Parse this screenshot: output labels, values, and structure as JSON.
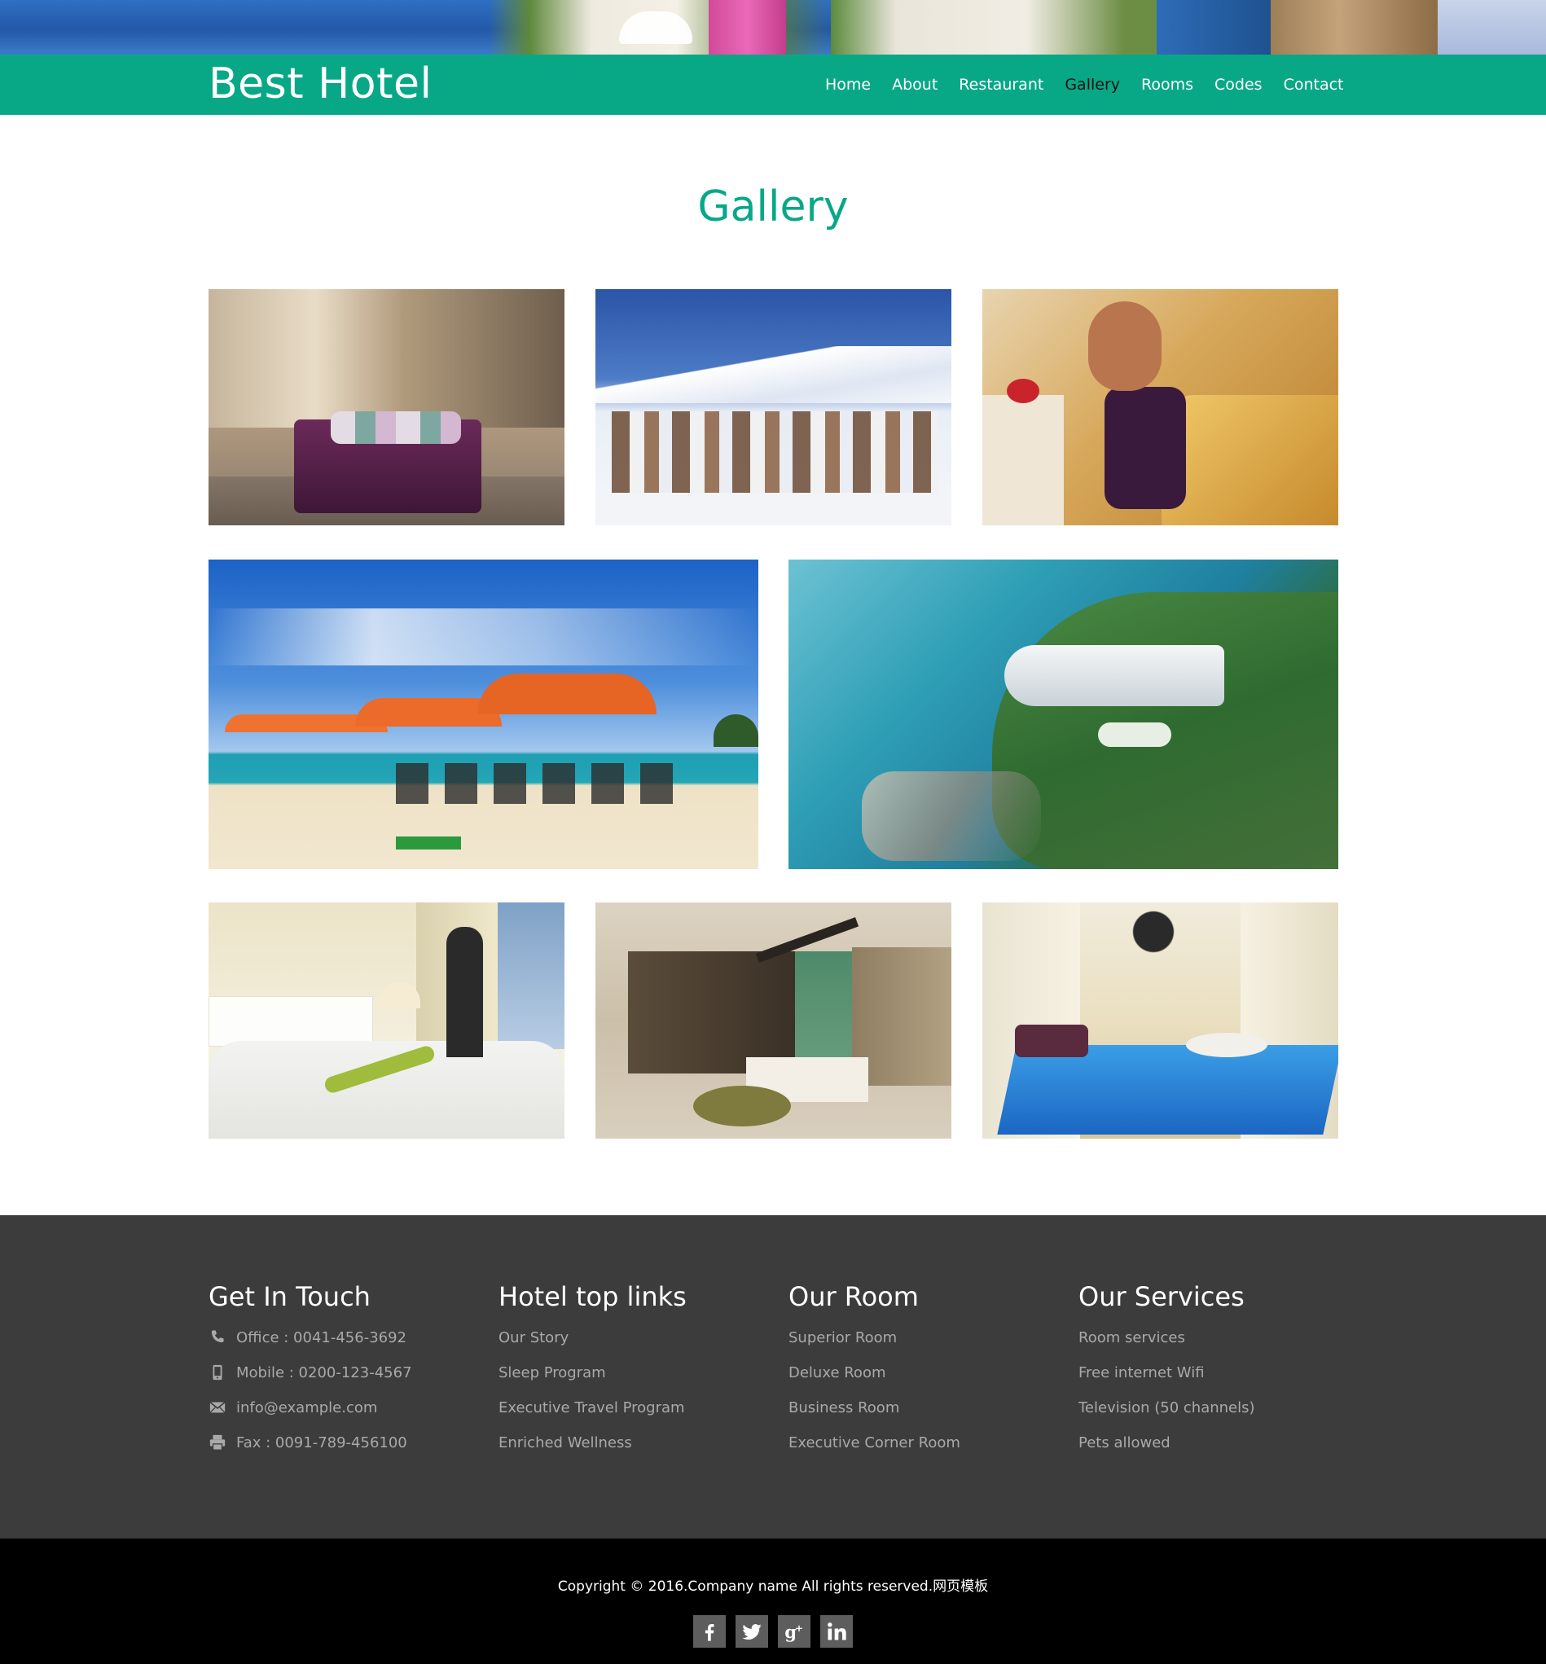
{
  "site": {
    "brand": "Best Hotel",
    "nav": [
      {
        "label": "Home",
        "active": false
      },
      {
        "label": "About",
        "active": false
      },
      {
        "label": "Restaurant",
        "active": false
      },
      {
        "label": "Gallery",
        "active": true
      },
      {
        "label": "Rooms",
        "active": false
      },
      {
        "label": "Codes",
        "active": false
      },
      {
        "label": "Contact",
        "active": false
      }
    ],
    "accent_color": "#08a887",
    "active_nav_color": "#111111"
  },
  "gallery": {
    "title": "Gallery",
    "photos": [
      {
        "subject": "lobby lounge with purple sofa"
      },
      {
        "subject": "snowy mountain village"
      },
      {
        "subject": "woman with wine glass in golden room"
      },
      {
        "subject": "beach with orange umbrellas"
      },
      {
        "subject": "aerial view of ship-shaped hotel on cliff"
      },
      {
        "subject": "bedroom with woman at window"
      },
      {
        "subject": "hotel indigo lobby reception"
      },
      {
        "subject": "indoor swimming pool with chandelier"
      }
    ]
  },
  "footer": {
    "background": "#3c3c3c",
    "columns": [
      {
        "title": "Get In Touch",
        "items": [
          {
            "icon": "phone-icon",
            "text": "Office : 0041-456-3692"
          },
          {
            "icon": "mobile-icon",
            "text": "Mobile : 0200-123-4567"
          },
          {
            "icon": "envelope-icon",
            "text": "info@example.com"
          },
          {
            "icon": "printer-icon",
            "text": "Fax : 0091-789-456100"
          }
        ]
      },
      {
        "title": "Hotel top links",
        "items": [
          {
            "text": "Our Story"
          },
          {
            "text": "Sleep Program"
          },
          {
            "text": "Executive Travel Program"
          },
          {
            "text": "Enriched Wellness"
          }
        ]
      },
      {
        "title": "Our Room",
        "items": [
          {
            "text": "Superior Room"
          },
          {
            "text": "Deluxe Room"
          },
          {
            "text": "Business Room"
          },
          {
            "text": "Executive Corner Room"
          }
        ]
      },
      {
        "title": "Our Services",
        "items": [
          {
            "text": "Room services"
          },
          {
            "text": "Free internet Wifi"
          },
          {
            "text": "Television (50 channels)"
          },
          {
            "text": "Pets allowed"
          }
        ]
      }
    ],
    "copyright": "Copyright © 2016.Company name All rights reserved.网页模板",
    "socials": [
      {
        "icon": "facebook-icon"
      },
      {
        "icon": "twitter-icon"
      },
      {
        "icon": "google-plus-icon"
      },
      {
        "icon": "linkedin-icon"
      }
    ]
  }
}
